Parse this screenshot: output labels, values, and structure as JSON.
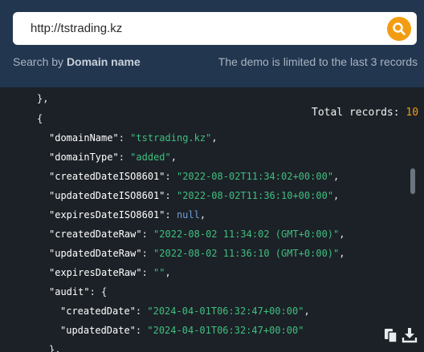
{
  "search": {
    "value": "http://tstrading.kz"
  },
  "hints": {
    "left_prefix": "Search by ",
    "left_bold": "Domain name",
    "right": "The demo is limited to the last 3 records"
  },
  "total": {
    "label": "Total records: ",
    "value": "10"
  },
  "json_fragment": {
    "prev_close": "},",
    "open_brace": "{",
    "domainName": "tstrading.kz",
    "domainType": "added",
    "createdDateISO8601": "2022-08-02T11:34:02+00:00",
    "updatedDateISO8601": "2022-08-02T11:36:10+00:00",
    "expiresDateISO8601": "null",
    "createdDateRaw": "2022-08-02 11:34:02 (GMT+0:00)",
    "updatedDateRaw": "2022-08-02 11:36:10 (GMT+0:00)",
    "expiresDateRaw": "",
    "audit": {
      "createdDate": "2024-04-01T06:32:47+00:00",
      "updatedDate": "2024-04-01T06:32:47+00:00"
    },
    "audit_close": "},"
  },
  "icons": {
    "search": "search-icon",
    "copy": "copy-icon",
    "download": "download-icon"
  },
  "colors": {
    "header": "#22364f",
    "accent": "#f39c12",
    "string": "#3fbf7f",
    "null": "#6f9fd8"
  }
}
